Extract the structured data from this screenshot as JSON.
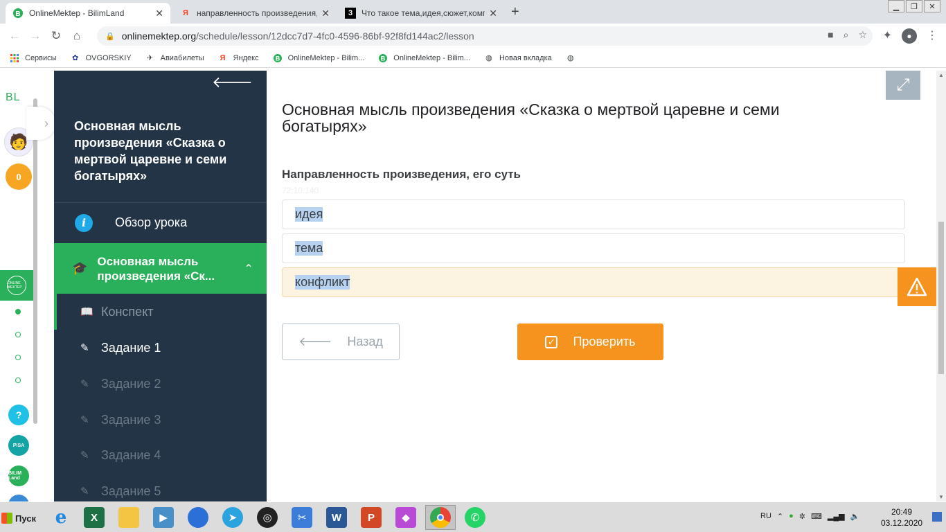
{
  "tabs": [
    {
      "title": "OnlineMektep - BilimLand",
      "icon": "B",
      "color": "#2ab05a",
      "active": true
    },
    {
      "title": "направленность произведения,и его с",
      "icon": "Я",
      "color": "#fc3f1d",
      "active": false
    },
    {
      "title": "Что такое тема,идея,сюжет,компози",
      "icon": "3",
      "color": "#000000",
      "active": false
    }
  ],
  "address": {
    "domain": "onlinemektep.org",
    "path": "/schedule/lesson/12dcc7d7-4fc0-4596-86bf-92f8fd144ac2/lesson"
  },
  "bookmarks": [
    {
      "label": "Сервисы",
      "icon": "apps-icon"
    },
    {
      "label": "OVGORSKIY",
      "icon": "globe-icon"
    },
    {
      "label": "Авиабилеты",
      "icon": "plane-icon"
    },
    {
      "label": "Яндекс",
      "icon": "yandex-icon"
    },
    {
      "label": "OnlineMektep - Bilim...",
      "icon": "bilimland-icon"
    },
    {
      "label": "OnlineMektep - Bilim...",
      "icon": "bilimland-icon"
    },
    {
      "label": "Новая вкладка",
      "icon": "globe-icon"
    }
  ],
  "rail": {
    "logo": "BL",
    "coins": "0",
    "online_mektep": "ONLINE MEKTEP",
    "help": "?",
    "pisa": "PISA",
    "bilimland": "BILIM Land"
  },
  "sidebar": {
    "lesson_title": "Основная мысль произведения «Сказка о мертвой царевне и семи богатырях»",
    "overview": "Обзор урока",
    "current_section": "Основная мысль произведения «Ск...",
    "items": [
      {
        "label": "Конспект",
        "state": "visited"
      },
      {
        "label": "Задание 1",
        "state": "active"
      },
      {
        "label": "Задание 2",
        "state": "locked"
      },
      {
        "label": "Задание 3",
        "state": "locked"
      },
      {
        "label": "Задание 4",
        "state": "locked"
      },
      {
        "label": "Задание 5",
        "state": "locked"
      }
    ]
  },
  "main": {
    "title": "Основная мысль произведения «Сказка о мертвой царевне и семи богатырях»",
    "question": "Направленность произведения, его суть",
    "timer": "72:10:140",
    "options": [
      "идея",
      "тема",
      "конфликт"
    ],
    "back_label": "Назад",
    "check_label": "Проверить"
  },
  "taskbar": {
    "start": "Пуск",
    "lang": "RU",
    "time": "20:49",
    "date": "03.12.2020"
  },
  "colors": {
    "green": "#2ab05a",
    "orange": "#f6921e",
    "sidebar": "#243447",
    "info": "#1fa9e6"
  }
}
